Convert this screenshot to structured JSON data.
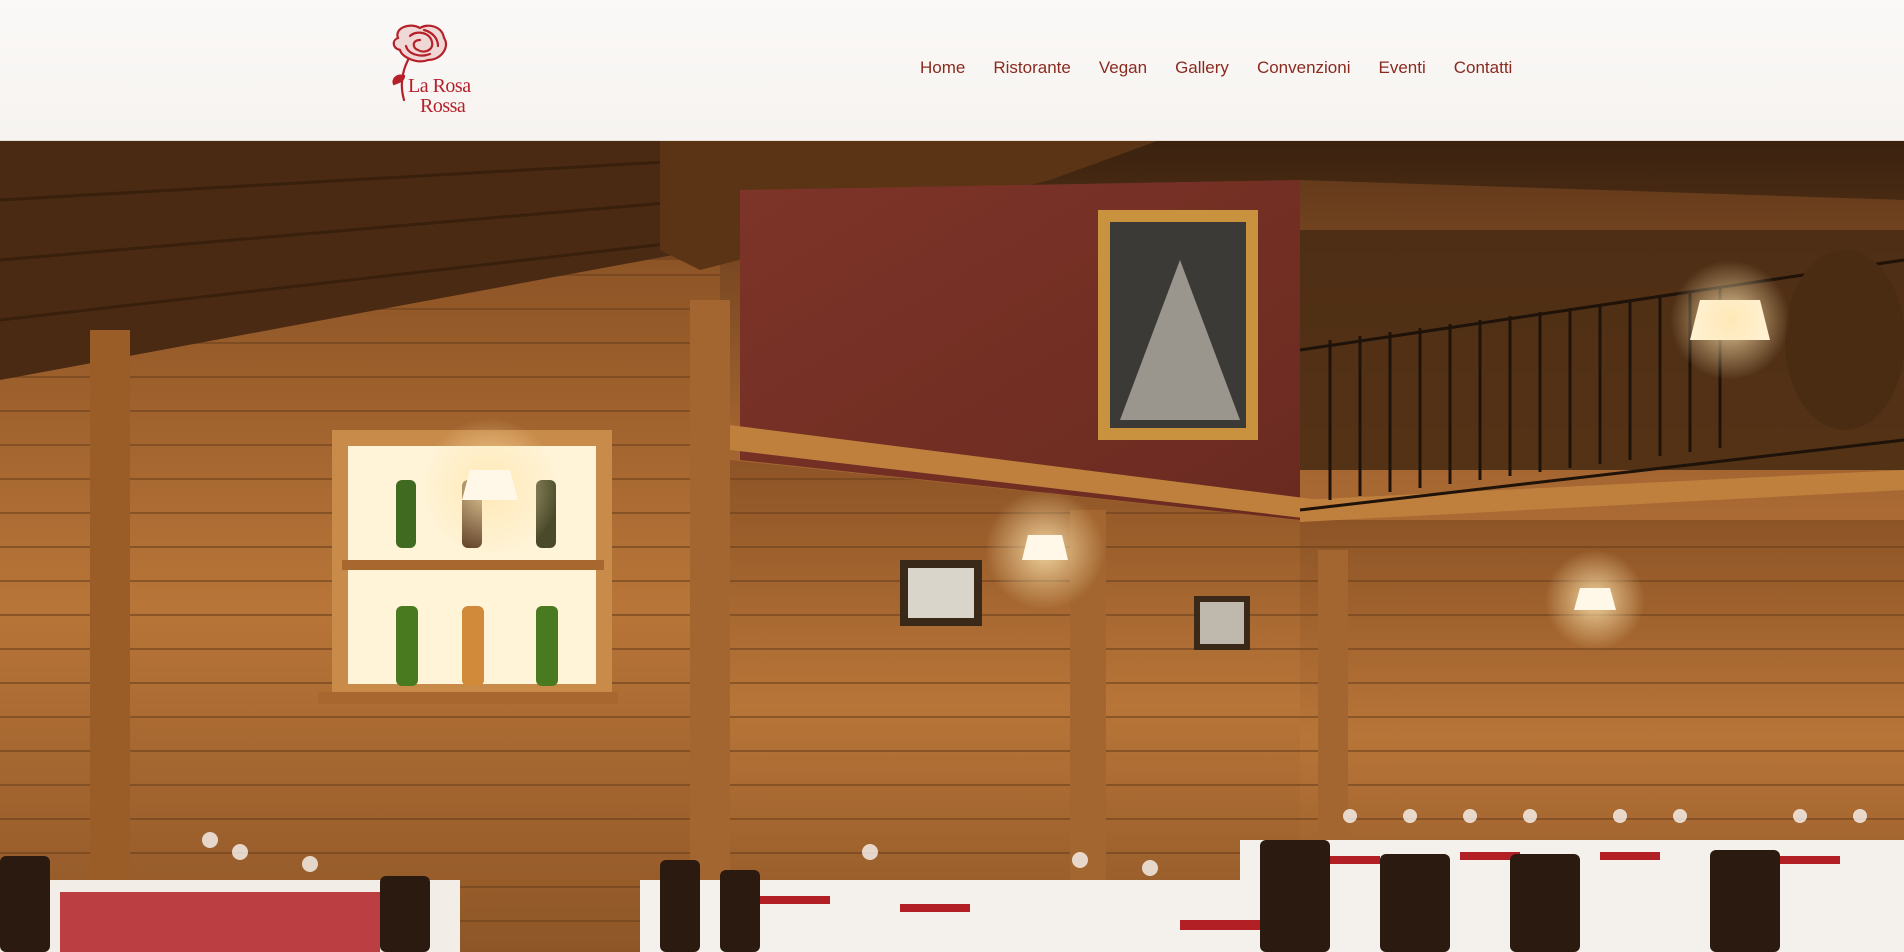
{
  "brand": {
    "name_line1": "La Rosa",
    "name_line2": "Rossa",
    "logo_color": "#b5202a"
  },
  "nav": {
    "items": [
      {
        "label": "Home"
      },
      {
        "label": "Ristorante"
      },
      {
        "label": "Vegan"
      },
      {
        "label": "Gallery"
      },
      {
        "label": "Convenzioni"
      },
      {
        "label": "Eventi"
      },
      {
        "label": "Contatti"
      }
    ],
    "text_color": "#8a2a1f"
  },
  "hero": {
    "subject": "restaurant-dining-room-photo",
    "colors": {
      "wood": "#b5723a",
      "wall": "#7a3226",
      "tablecloth": "#f4f1ec",
      "napkin": "#b21f24"
    }
  }
}
